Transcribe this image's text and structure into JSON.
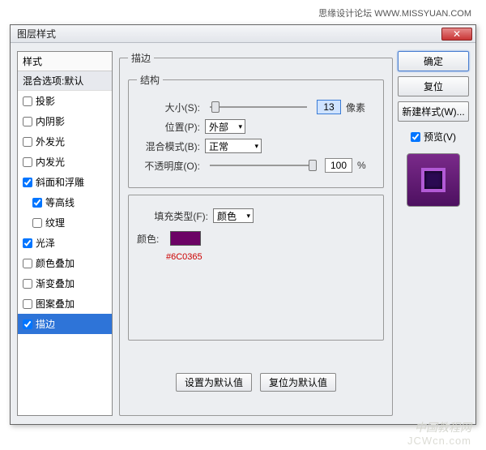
{
  "top_text": "思缘设计论坛  WWW.MISSYUAN.COM",
  "dialog": {
    "title": "图层样式"
  },
  "styles": {
    "header": "样式",
    "blend_row": "混合选项:默认",
    "items": [
      {
        "label": "投影",
        "checked": false
      },
      {
        "label": "内阴影",
        "checked": false
      },
      {
        "label": "外发光",
        "checked": false
      },
      {
        "label": "内发光",
        "checked": false
      },
      {
        "label": "斜面和浮雕",
        "checked": true
      },
      {
        "label": "等高线",
        "checked": true,
        "indent": true
      },
      {
        "label": "纹理",
        "checked": false,
        "indent": true
      },
      {
        "label": "光泽",
        "checked": true
      },
      {
        "label": "颜色叠加",
        "checked": false
      },
      {
        "label": "渐变叠加",
        "checked": false
      },
      {
        "label": "图案叠加",
        "checked": false
      },
      {
        "label": "描边",
        "checked": true,
        "selected": true
      }
    ]
  },
  "stroke": {
    "legend_outer": "描边",
    "legend_struct": "结构",
    "size_label": "大小(S):",
    "size_value": "13",
    "size_unit": "像素",
    "position_label": "位置(P):",
    "position_value": "外部",
    "blend_label": "混合模式(B):",
    "blend_value": "正常",
    "opacity_label": "不透明度(O):",
    "opacity_value": "100",
    "opacity_unit": "%",
    "fill_label": "填充类型(F):",
    "fill_value": "颜色",
    "color_label": "颜色:",
    "color_hex": "#6C0365",
    "btn_default": "设置为默认值",
    "btn_reset": "复位为默认值"
  },
  "right": {
    "ok": "确定",
    "cancel": "复位",
    "newstyle": "新建样式(W)...",
    "preview_label": "预览(V)"
  },
  "watermark1": "中国教程网",
  "watermark2": "JCWcn.com"
}
